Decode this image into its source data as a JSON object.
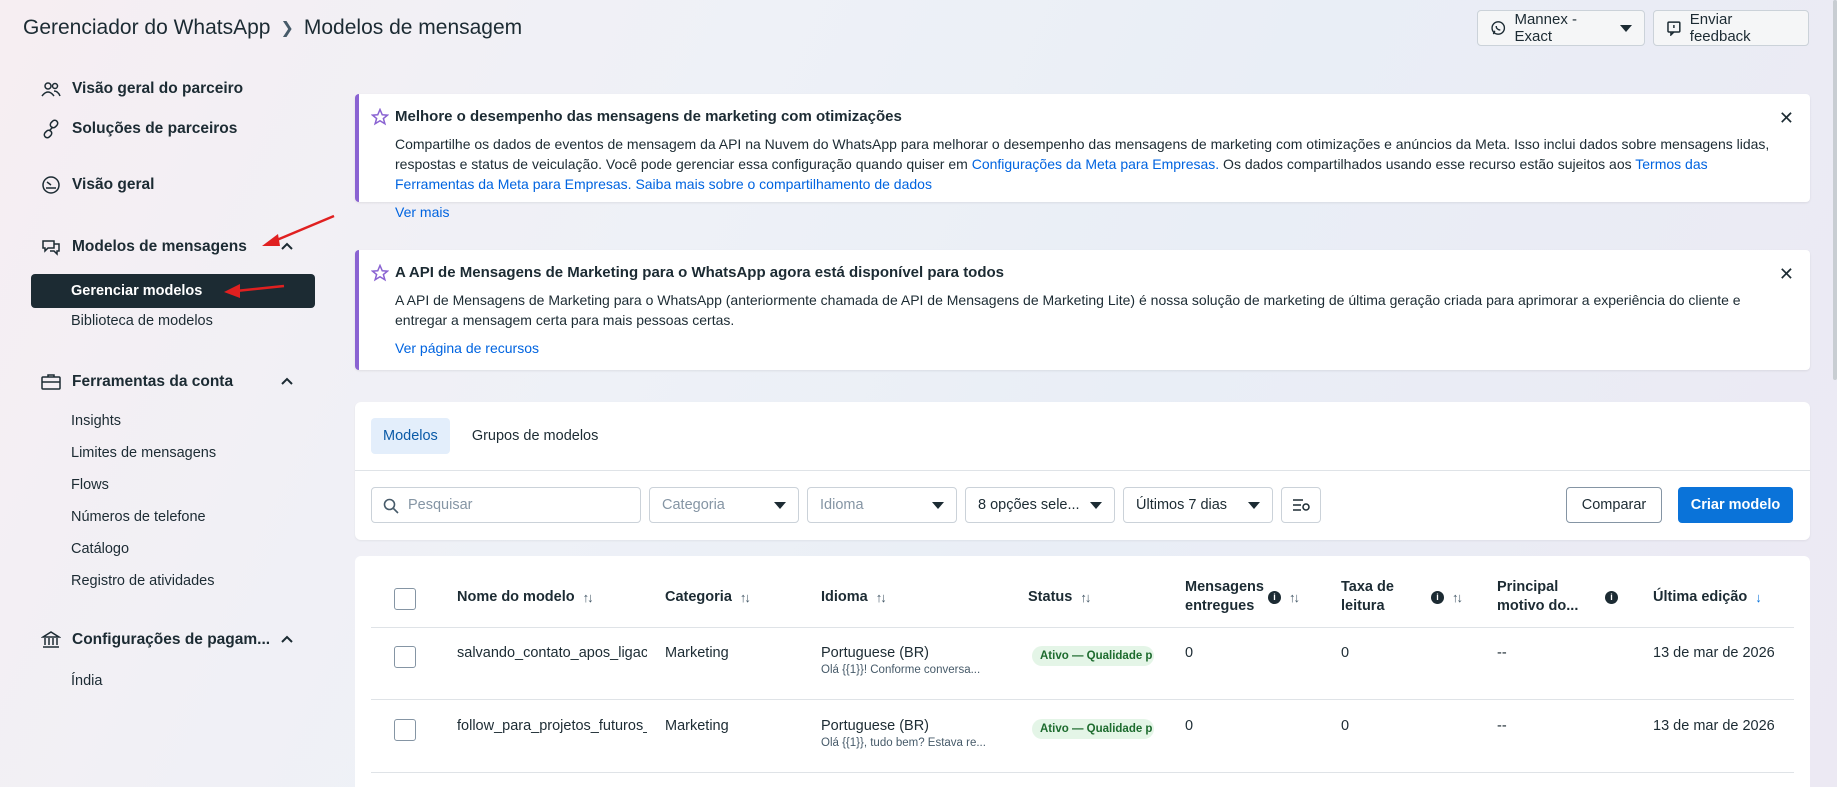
{
  "header": {
    "app_title": "Gerenciador do WhatsApp",
    "page_title": "Modelos de mensagem",
    "account_label": "Mannex -Exact",
    "feedback_label": "Enviar feedback"
  },
  "sidebar": {
    "partner_overview": "Visão geral do parceiro",
    "partner_solutions": "Soluções de parceiros",
    "overview": "Visão geral",
    "message_templates": {
      "label": "Modelos de mensagens",
      "items": [
        "Gerenciar modelos",
        "Biblioteca de modelos"
      ]
    },
    "account_tools": {
      "label": "Ferramentas da conta",
      "items": [
        "Insights",
        "Limites de mensagens",
        "Flows",
        "Números de telefone",
        "Catálogo",
        "Registro de atividades"
      ]
    },
    "payment_settings": {
      "label": "Configurações de pagam...",
      "items": [
        "Índia"
      ]
    }
  },
  "banner1": {
    "title": "Melhore o desempenho das mensagens de marketing com otimizações",
    "text1": "Compartilhe os dados de eventos de mensagem da API na Nuvem do WhatsApp para melhorar o desempenho das mensagens de marketing com otimizações e anúncios da Meta. Isso inclui dados sobre mensagens lidas, respostas e status de veiculação. Você pode gerenciar essa configuração quando quiser em ",
    "link1": "Configurações da Meta para Empresas.",
    "text2": " Os dados compartilhados usando esse recurso estão sujeitos aos ",
    "link2": "Termos das Ferramentas da Meta para Empresas.",
    "text3": " ",
    "link3": "Saiba mais sobre o compartilhamento de dados",
    "more": "Ver mais"
  },
  "banner2": {
    "title": "A API de Mensagens de Marketing para o WhatsApp agora está disponível para todos",
    "text": "A API de Mensagens de Marketing para o WhatsApp (anteriormente chamada de API de Mensagens de Marketing Lite) é nossa solução de marketing de última geração criada para aprimorar a experiência do cliente e entregar a mensagem certa para mais pessoas certas.",
    "more": "Ver página de recursos"
  },
  "tabs": [
    "Modelos",
    "Grupos de modelos"
  ],
  "filters": {
    "search_placeholder": "Pesquisar",
    "category": "Categoria",
    "language": "Idioma",
    "status": "8 opções sele...",
    "date": "Últimos 7 dias",
    "compare": "Comparar",
    "create": "Criar modelo"
  },
  "table": {
    "columns": {
      "name": "Nome do modelo",
      "category": "Categoria",
      "language": "Idioma",
      "status": "Status",
      "delivered": "Mensagens entregues",
      "read_rate": "Taxa de leitura",
      "top_reason": "Principal motivo do...",
      "last_edit": "Última edição"
    },
    "rows": [
      {
        "name": "salvando_contato_apos_ligaca",
        "category": "Marketing",
        "language": "Portuguese (BR)",
        "preview": "Olá {{1}}! Conforme conversa...",
        "status": "Ativo — Qualidade p",
        "delivered": "0",
        "read_rate": "0",
        "top_reason": "--",
        "last_edit": "13 de mar de 2026"
      },
      {
        "name": "follow_para_projetos_futuros_",
        "category": "Marketing",
        "language": "Portuguese (BR)",
        "preview": "Olá {{1}}, tudo bem? Estava re...",
        "status": "Ativo — Qualidade p",
        "delivered": "0",
        "read_rate": "0",
        "top_reason": "--",
        "last_edit": "13 de mar de 2026"
      }
    ]
  },
  "colors": {
    "accent": "#0a73d9",
    "banner_border": "#8a63d2",
    "nav_active": "#1c2b33",
    "annotation_arrow": "#e02020"
  }
}
